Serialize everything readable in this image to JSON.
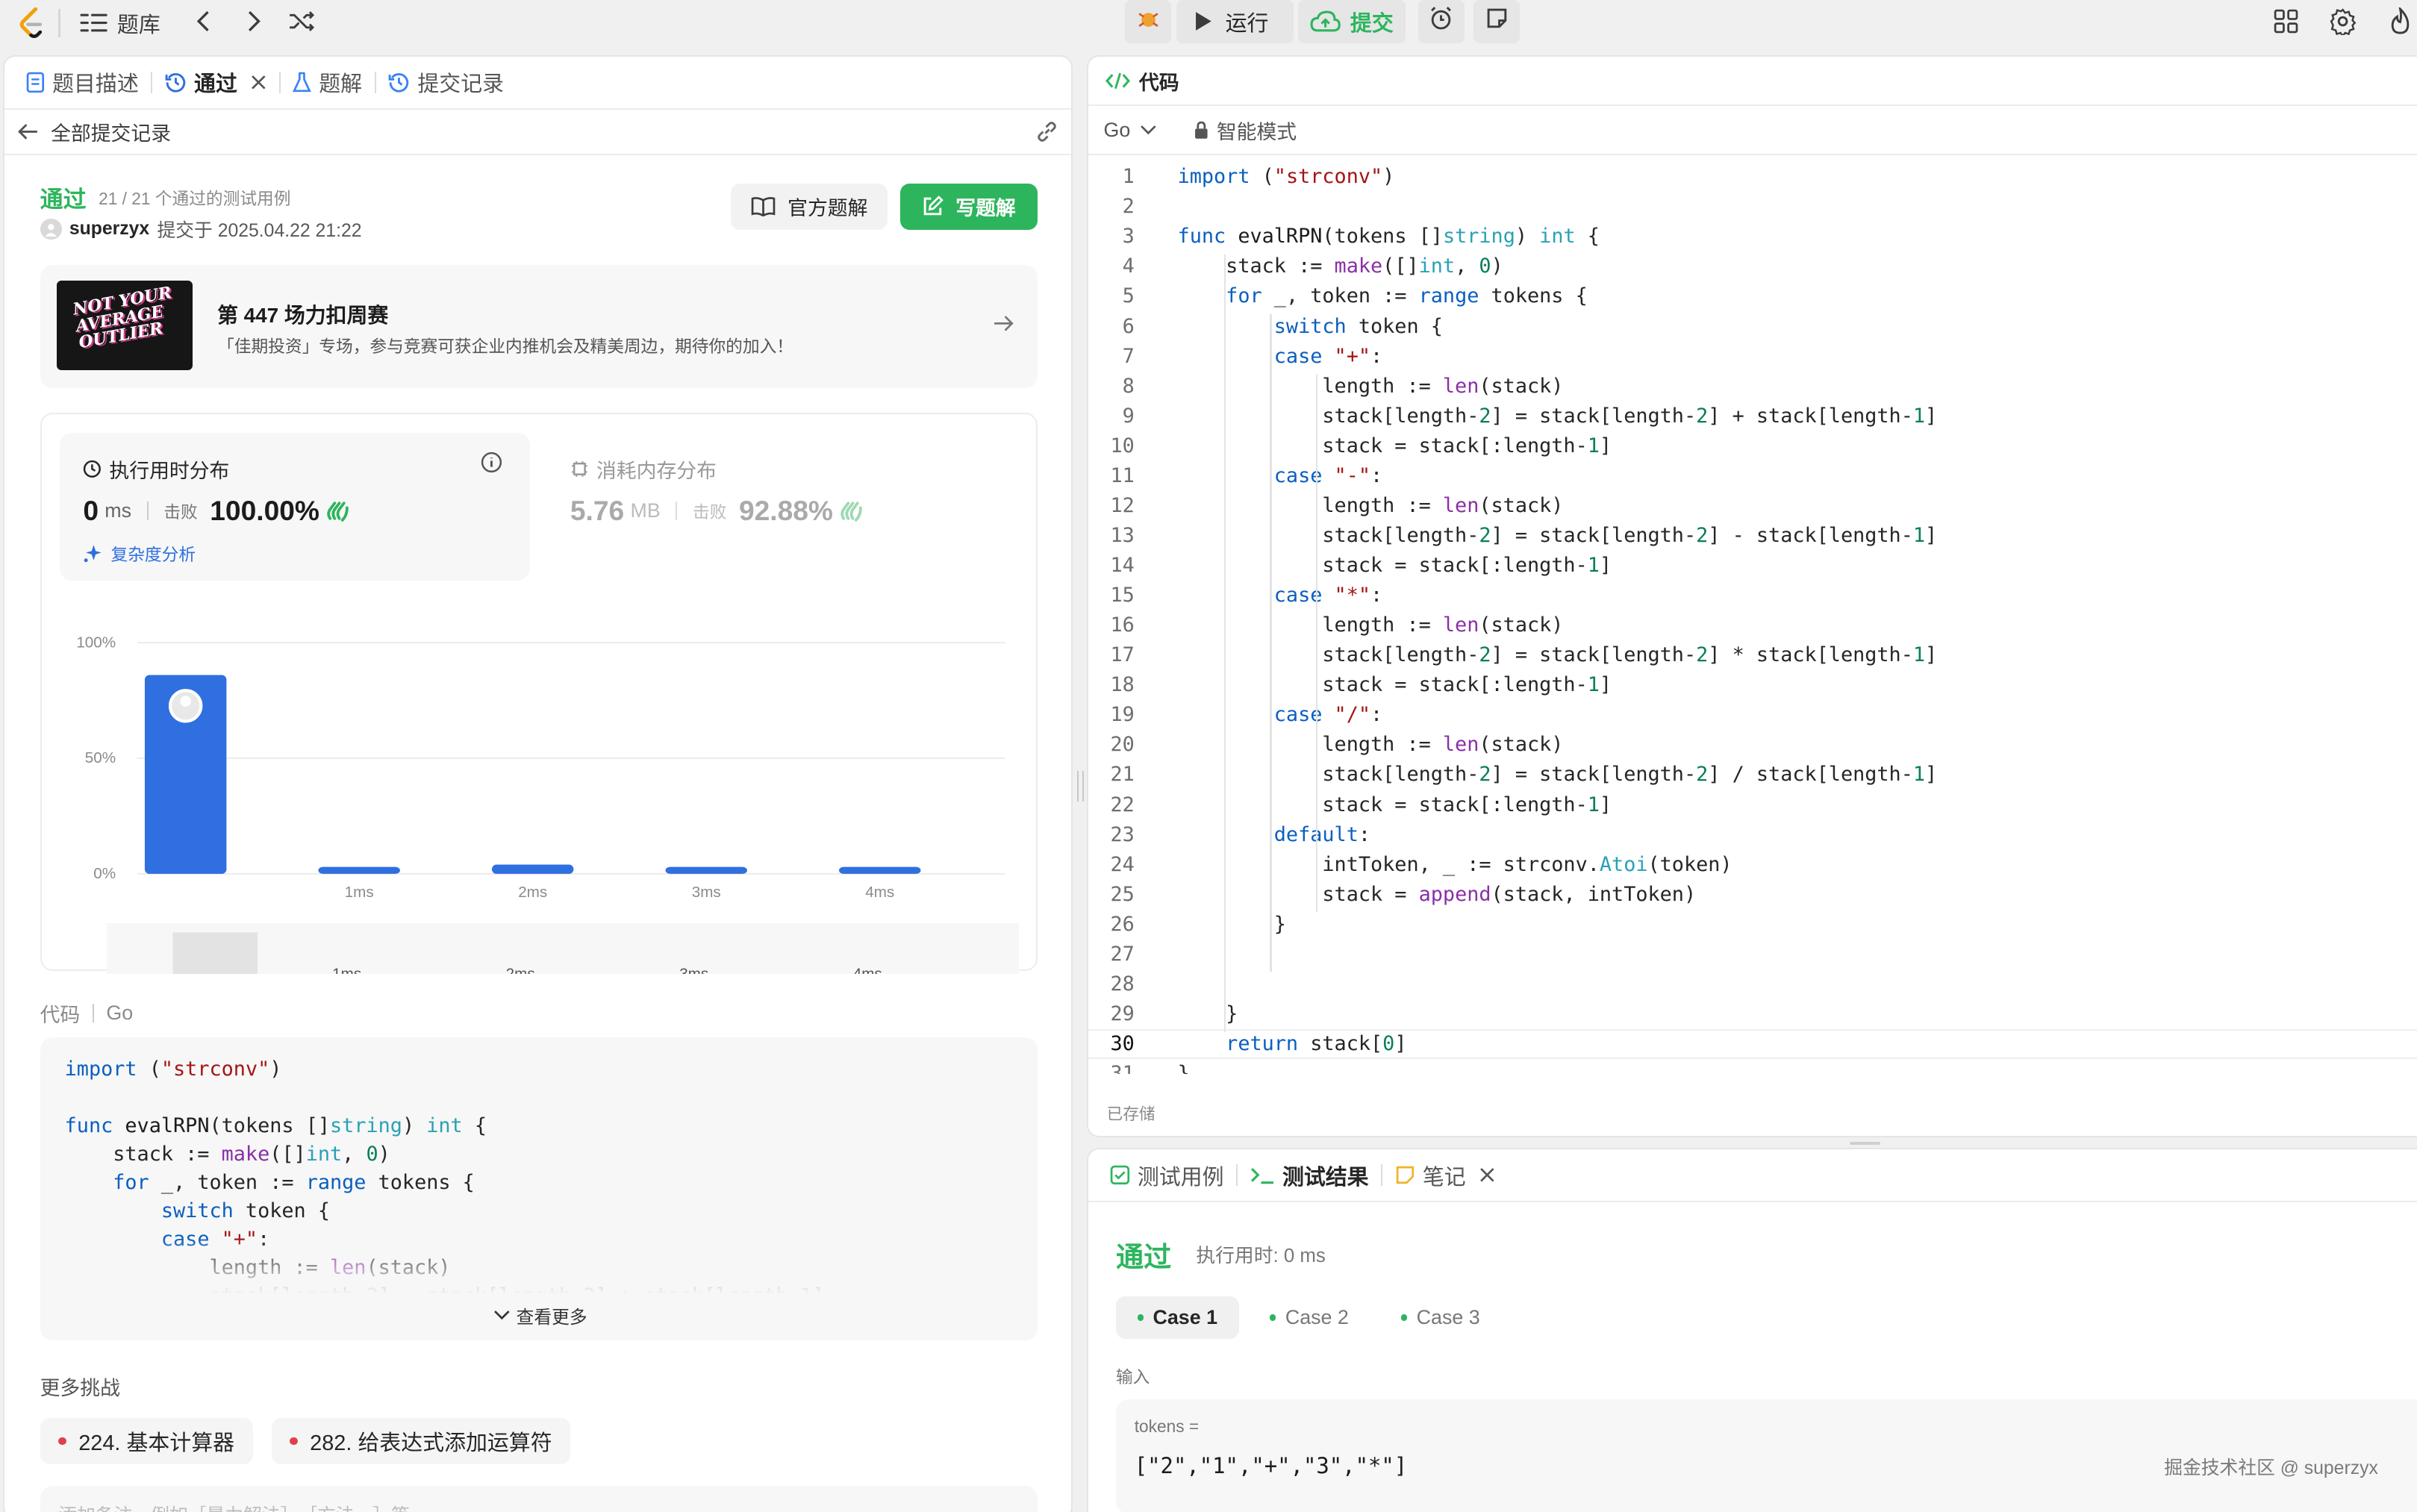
{
  "topbar": {
    "nav_title": "题库",
    "run_label": "运行",
    "submit_label": "提交"
  },
  "left": {
    "tabs": [
      {
        "label": "题目描述"
      },
      {
        "label": "通过"
      },
      {
        "label": "题解"
      },
      {
        "label": "提交记录"
      }
    ],
    "back_label": "全部提交记录",
    "status": "通过",
    "cases": "21 / 21 个通过的测试用例",
    "user": "superzyx",
    "submitted_at": "提交于 2025.04.22 21:22",
    "official_btn": "官方题解",
    "write_btn": "写题解",
    "banner": {
      "title": "第 447 场力扣周赛",
      "subtitle": "「佳期投资」专场，参与竞赛可获企业内推机会及精美周边，期待你的加入！",
      "logo_text": "NOT YOUR AVERAGE OUTLIER"
    },
    "runtime": {
      "title": "执行用时分布",
      "value": "0",
      "unit": "ms",
      "beat_label": "击败",
      "beat": "100.00%",
      "complexity": "复杂度分析"
    },
    "memory": {
      "title": "消耗内存分布",
      "value": "5.76",
      "unit": "MB",
      "beat_label": "击败",
      "beat": "92.88%"
    },
    "code_label": "代码",
    "code_lang": "Go",
    "more_label": "查看更多",
    "challenges_label": "更多挑战",
    "challenges": [
      "224. 基本计算器",
      "282. 给表达式添加运算符"
    ],
    "note_placeholder": "添加备注，例如［暴力解法］，［方法一］等"
  },
  "chart_data": {
    "type": "bar",
    "categories": [
      "",
      "1ms",
      "2ms",
      "3ms",
      "4ms"
    ],
    "values": [
      86,
      3,
      4,
      3,
      3
    ],
    "ylim": [
      0,
      100
    ],
    "yticks": [
      "100%",
      "50%",
      "0%"
    ],
    "grid": true,
    "highlight_color": "#2f6fe0"
  },
  "editor": {
    "title": "代码",
    "lang": "Go",
    "mode": "智能模式",
    "saved": "已存储",
    "lines": [
      "import (\"strconv\")",
      "",
      "func evalRPN(tokens []string) int {",
      "    stack := make([]int, 0)",
      "    for _, token := range tokens {",
      "        switch token {",
      "        case \"+\":",
      "            length := len(stack)",
      "            stack[length-2] = stack[length-2] + stack[length-1]",
      "            stack = stack[:length-1]",
      "        case \"-\":",
      "            length := len(stack)",
      "            stack[length-2] = stack[length-2] - stack[length-1]",
      "            stack = stack[:length-1]",
      "        case \"*\":",
      "            length := len(stack)",
      "            stack[length-2] = stack[length-2] * stack[length-1]",
      "            stack = stack[:length-1]",
      "        case \"/\":",
      "            length := len(stack)",
      "            stack[length-2] = stack[length-2] / stack[length-1]",
      "            stack = stack[:length-1]",
      "        default:",
      "            intToken, _ := strconv.Atoi(token)",
      "            stack = append(stack, intToken)",
      "        }",
      "",
      "",
      "    }",
      "    return stack[0]",
      "}"
    ],
    "current_line": 30
  },
  "bottom": {
    "tabs": [
      {
        "label": "测试用例"
      },
      {
        "label": "测试结果"
      },
      {
        "label": "笔记"
      }
    ],
    "status": "通过",
    "runtime": "执行用时: 0 ms",
    "cases": [
      "Case 1",
      "Case 2",
      "Case 3"
    ],
    "input_label": "输入",
    "var_label": "tokens =",
    "var_value": "[\"2\",\"1\",\"+\",\"3\",\"*\"]"
  },
  "watermark": "掘金技术社区 @ superzyx"
}
